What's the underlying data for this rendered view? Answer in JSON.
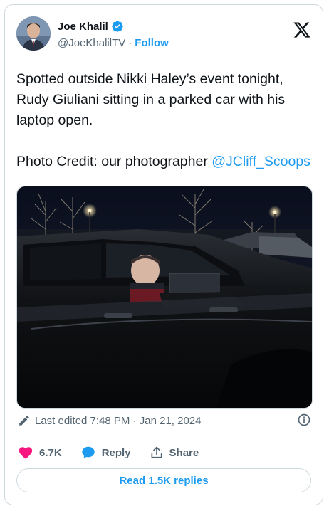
{
  "author": {
    "name": "Joe Khalil",
    "handle": "@JoeKhalilTV",
    "separator": "·",
    "follow_label": "Follow"
  },
  "tweet": {
    "text": "Spotted outside Nikki Haley’s event tonight, Rudy Giuliani sitting in a parked car with his laptop open.\n\nPhoto Credit: our photographer ",
    "mention": "@JCliff_Scoops"
  },
  "meta": {
    "edited_label": "Last edited 7:48 PM · Jan 21, 2024"
  },
  "actions": {
    "like_count": "6.7K",
    "reply_label": "Reply",
    "share_label": "Share"
  },
  "replies_button": "Read 1.5K replies",
  "colors": {
    "accent": "#1d9bf0",
    "like": "#f91880",
    "text": "#0f1419",
    "secondary": "#536471",
    "border": "#cfd9de"
  },
  "icons": {
    "verified": "verified-badge-icon",
    "logo": "x-logo-icon",
    "edit": "pencil-icon",
    "info": "info-icon",
    "like": "heart-icon",
    "reply": "speech-bubble-icon",
    "share": "share-upload-icon"
  }
}
